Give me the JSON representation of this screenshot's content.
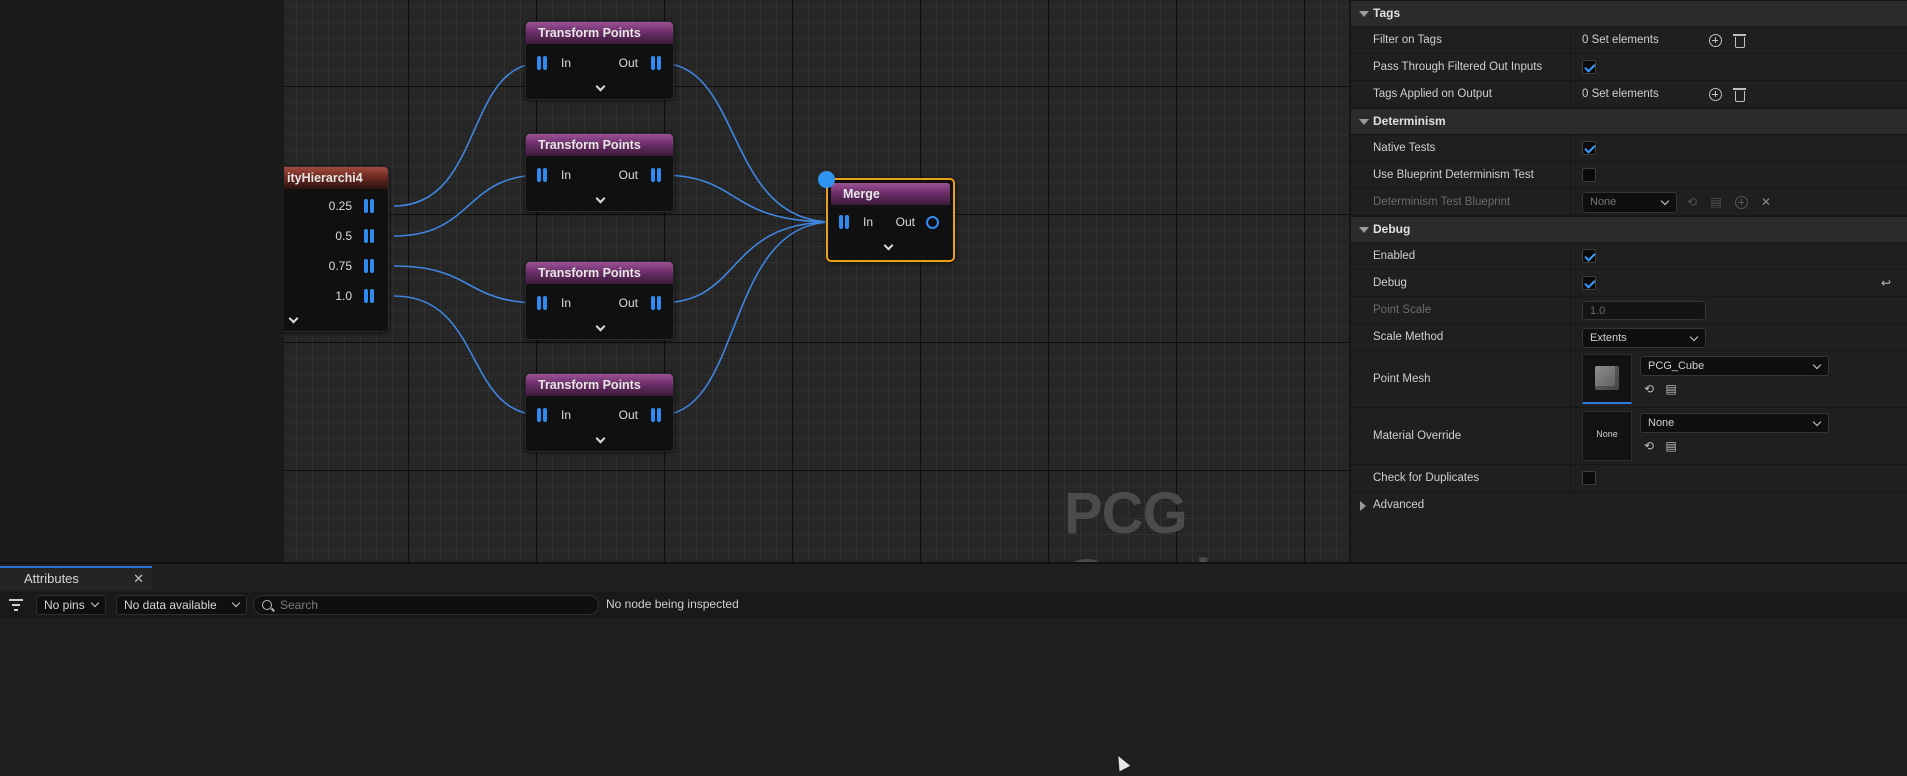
{
  "graph": {
    "watermark": "PCG Graph",
    "hierarchy_node": {
      "title": "ityHierarchi4",
      "pins": [
        "0.25",
        "0.5",
        "0.75",
        "1.0"
      ]
    },
    "transform_nodes": [
      {
        "title": "Transform Points",
        "in": "In",
        "out": "Out"
      },
      {
        "title": "Transform Points",
        "in": "In",
        "out": "Out"
      },
      {
        "title": "Transform Points",
        "in": "In",
        "out": "Out"
      },
      {
        "title": "Transform Points",
        "in": "In",
        "out": "Out"
      }
    ],
    "merge_node": {
      "title": "Merge",
      "in": "In",
      "out": "Out",
      "selected": true
    },
    "wire_color": "#3f86e0",
    "pin_color": "#2f8bf0",
    "selection_color": "#e8a018"
  },
  "details": {
    "tags": {
      "header": "Tags",
      "rows": [
        {
          "label": "Filter on Tags",
          "value": "0 Set elements"
        },
        {
          "label": "Pass Through Filtered Out Inputs",
          "checked": true
        },
        {
          "label": "Tags Applied on Output",
          "value": "0 Set elements"
        }
      ]
    },
    "determinism": {
      "header": "Determinism",
      "rows": [
        {
          "label": "Native Tests",
          "checked": true
        },
        {
          "label": "Use Blueprint Determinism Test",
          "checked": false
        },
        {
          "label": "Determinism Test Blueprint",
          "value": "None",
          "disabled": true
        }
      ]
    },
    "debug": {
      "header": "Debug",
      "rows": [
        {
          "label": "Enabled",
          "checked": true
        },
        {
          "label": "Debug",
          "checked": true
        },
        {
          "label": "Point Scale",
          "value": "1.0",
          "disabled": true
        },
        {
          "label": "Scale Method",
          "value": "Extents"
        },
        {
          "label": "Point Mesh",
          "value": "PCG_Cube"
        },
        {
          "label": "Material Override",
          "value": "None",
          "thumb": "None"
        },
        {
          "label": "Check for Duplicates",
          "checked": false
        }
      ]
    },
    "advanced": {
      "header": "Advanced"
    }
  },
  "attributes": {
    "tab_label": "Attributes",
    "pins_dropdown": "No pins",
    "data_dropdown": "No data available",
    "search_placeholder": "Search",
    "status": "No node being inspected"
  }
}
